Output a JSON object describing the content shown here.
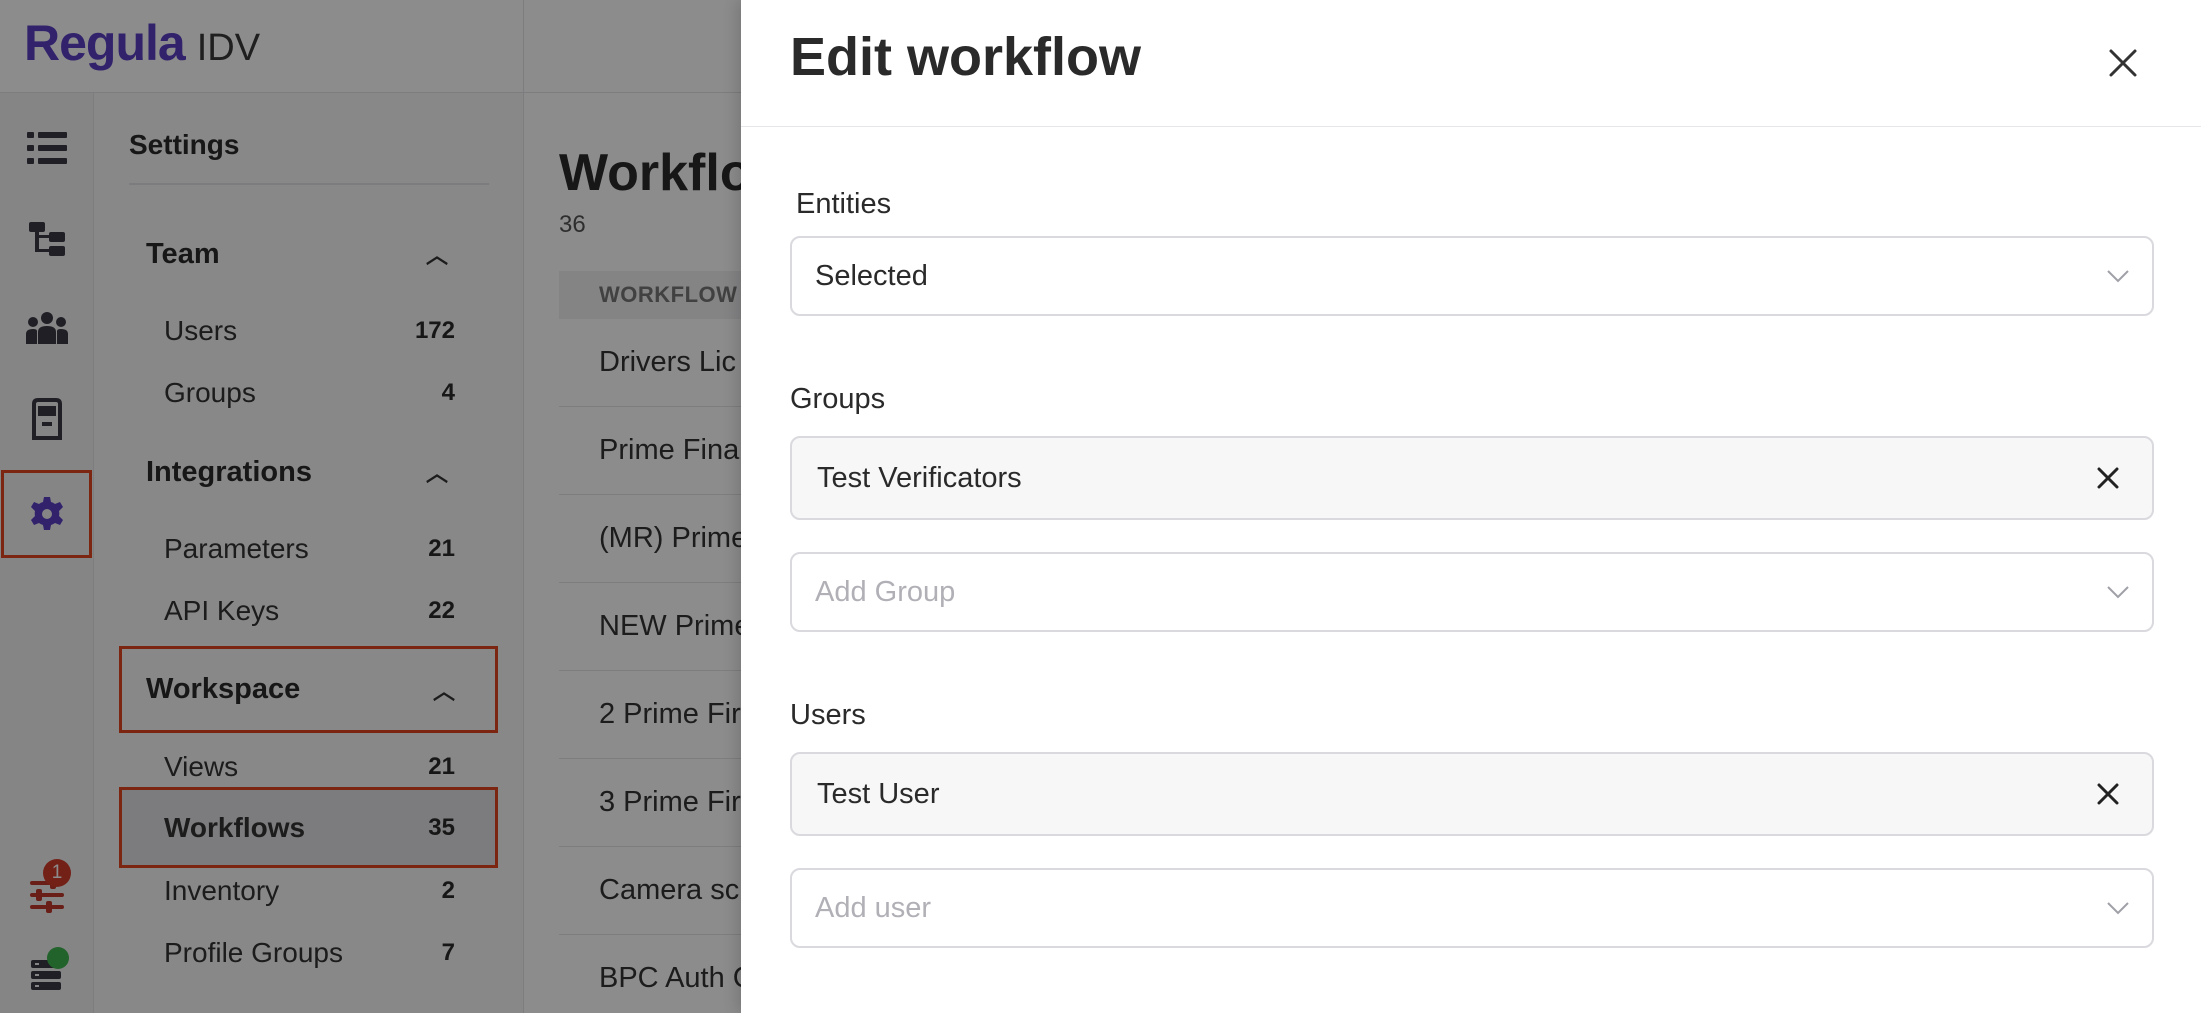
{
  "app": {
    "brand": "Regula",
    "suffix": "IDV"
  },
  "rail": {
    "icons": [
      "list-icon",
      "tree-icon",
      "people-icon",
      "kiosk-icon",
      "gear-icon",
      "sliders-icon",
      "server-icon"
    ],
    "notification_count": "1"
  },
  "settings": {
    "title": "Settings",
    "sections": [
      {
        "label": "Team",
        "items": [
          {
            "label": "Users",
            "count": "172"
          },
          {
            "label": "Groups",
            "count": "4"
          }
        ]
      },
      {
        "label": "Integrations",
        "items": [
          {
            "label": "Parameters",
            "count": "21"
          },
          {
            "label": "API Keys",
            "count": "22"
          }
        ]
      },
      {
        "label": "Workspace",
        "items": [
          {
            "label": "Views",
            "count": "21"
          },
          {
            "label": "Workflows",
            "count": "35"
          },
          {
            "label": "Inventory",
            "count": "2"
          },
          {
            "label": "Profile Groups",
            "count": "7"
          }
        ]
      }
    ]
  },
  "main": {
    "title": "Workflo",
    "count": "36",
    "column_header": "WORKFLOW",
    "rows": [
      "Drivers Lic",
      "Prime Fina",
      "(MR) Prime",
      "NEW Prime",
      "2 Prime Fir",
      "3 Prime Fir",
      "Camera sc",
      "BPC Auth C"
    ]
  },
  "drawer": {
    "title": "Edit workflow",
    "entities": {
      "label": "Entities",
      "value": "Selected"
    },
    "groups": {
      "label": "Groups",
      "tag": "Test Verificators",
      "add_placeholder": "Add Group"
    },
    "users": {
      "label": "Users",
      "tag": "Test User",
      "add_placeholder": "Add user"
    }
  },
  "colors": {
    "brand": "#5b3fc4",
    "highlight": "#e2451f",
    "badge": "#d23c2a",
    "status_dot": "#3fb34f"
  }
}
